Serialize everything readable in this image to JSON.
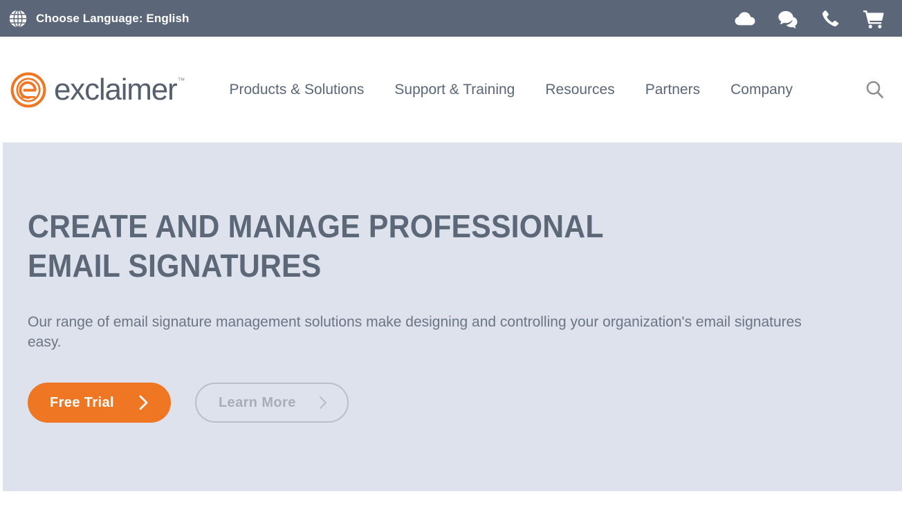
{
  "topbar": {
    "globe_icon": "globe-icon",
    "language_label": "Choose Language: English",
    "icons": [
      {
        "name": "cloud-icon",
        "label": "Cloud"
      },
      {
        "name": "chat-icon",
        "label": "Live Chat"
      },
      {
        "name": "phone-icon",
        "label": "Call"
      },
      {
        "name": "cart-icon",
        "label": "Cart"
      }
    ],
    "background_color": "#5b6779"
  },
  "header": {
    "logo": {
      "mark_icon": "exclaimer-logo-icon",
      "text": "exclaimer",
      "trademark": "™",
      "mark_color": "#ef7622",
      "text_color": "#555f6e"
    },
    "nav": [
      {
        "label": "Products & Solutions"
      },
      {
        "label": "Support & Training"
      },
      {
        "label": "Resources"
      },
      {
        "label": "Partners"
      },
      {
        "label": "Company"
      }
    ],
    "search_icon": "search-icon"
  },
  "hero": {
    "title": "Create and manage professional email signatures",
    "subtitle": "Our range of email signature management solutions make designing and controlling your organization's email signatures easy.",
    "primary_button": {
      "label": "Free Trial",
      "icon": "chevron-right-icon",
      "color": "#ef7622"
    },
    "secondary_button": {
      "label": "Learn More",
      "icon": "chevron-right-icon",
      "color": "#a6aeba"
    },
    "background_color": "#dde2ec",
    "title_color": "#5c6878"
  }
}
